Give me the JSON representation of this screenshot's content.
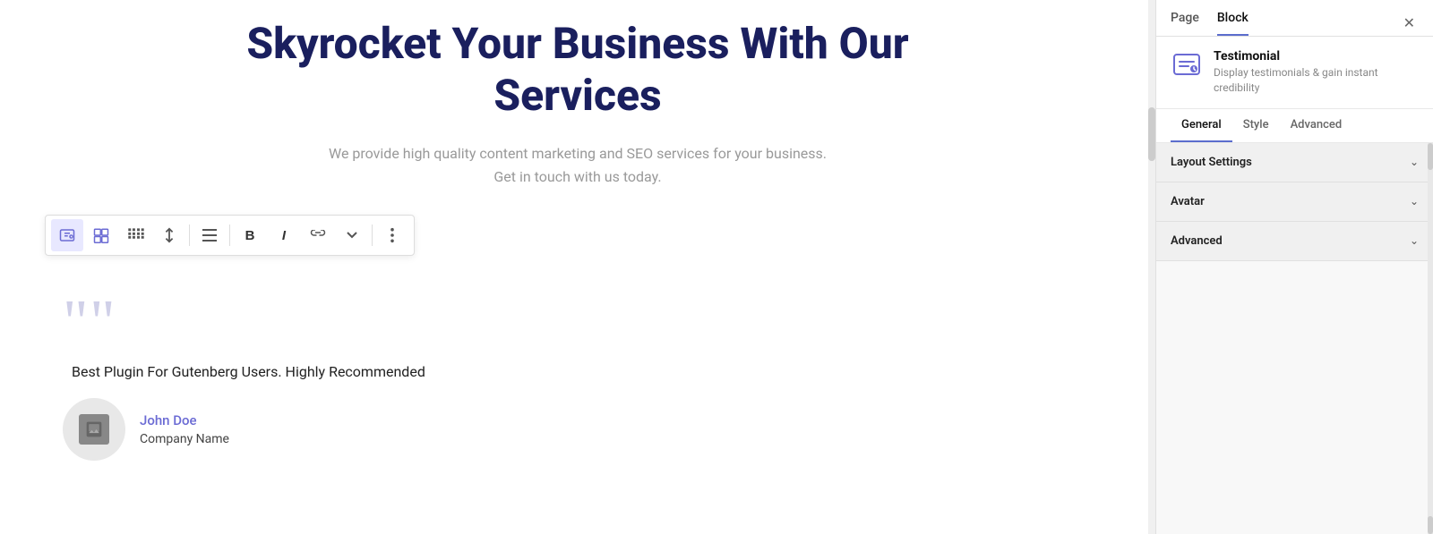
{
  "main": {
    "title": "Skyrocket Your Business With Our Services",
    "subtitle_line1": "We provide high quality content marketing and SEO services for your business.",
    "subtitle_line2": "Get in touch with us today.",
    "testimonial": {
      "quote_char": "❝❝",
      "text": "Best Plugin For Gutenberg Users. Highly Recommended",
      "author_name": "John Doe",
      "author_company": "Company Name"
    }
  },
  "toolbar": {
    "buttons": [
      {
        "id": "testimonial-icon",
        "label": "T",
        "icon": "testimonial"
      },
      {
        "id": "add-block",
        "label": "+",
        "icon": "plus-block"
      },
      {
        "id": "drag",
        "label": "⠿",
        "icon": "drag-handle"
      },
      {
        "id": "move-up-down",
        "label": "⇅",
        "icon": "up-down"
      },
      {
        "id": "align",
        "label": "≡",
        "icon": "align"
      },
      {
        "id": "bold",
        "label": "B",
        "icon": "bold"
      },
      {
        "id": "italic",
        "label": "I",
        "icon": "italic"
      },
      {
        "id": "link",
        "label": "⛓",
        "icon": "link"
      },
      {
        "id": "more-options",
        "label": "⋮",
        "icon": "more"
      }
    ]
  },
  "right_panel": {
    "top_tabs": [
      {
        "id": "page-tab",
        "label": "Page",
        "active": false
      },
      {
        "id": "block-tab",
        "label": "Block",
        "active": true
      }
    ],
    "close_label": "✕",
    "block_info": {
      "title": "Testimonial",
      "description": "Display testimonials & gain instant credibility"
    },
    "sub_tabs": [
      {
        "id": "general-tab",
        "label": "General",
        "active": true
      },
      {
        "id": "style-tab",
        "label": "Style",
        "active": false
      },
      {
        "id": "advanced-tab",
        "label": "Advanced",
        "active": false
      }
    ],
    "accordion_sections": [
      {
        "id": "layout-settings",
        "title": "Layout Settings",
        "expanded": false
      },
      {
        "id": "avatar",
        "title": "Avatar",
        "expanded": false
      },
      {
        "id": "advanced",
        "title": "Advanced",
        "expanded": false
      }
    ]
  }
}
